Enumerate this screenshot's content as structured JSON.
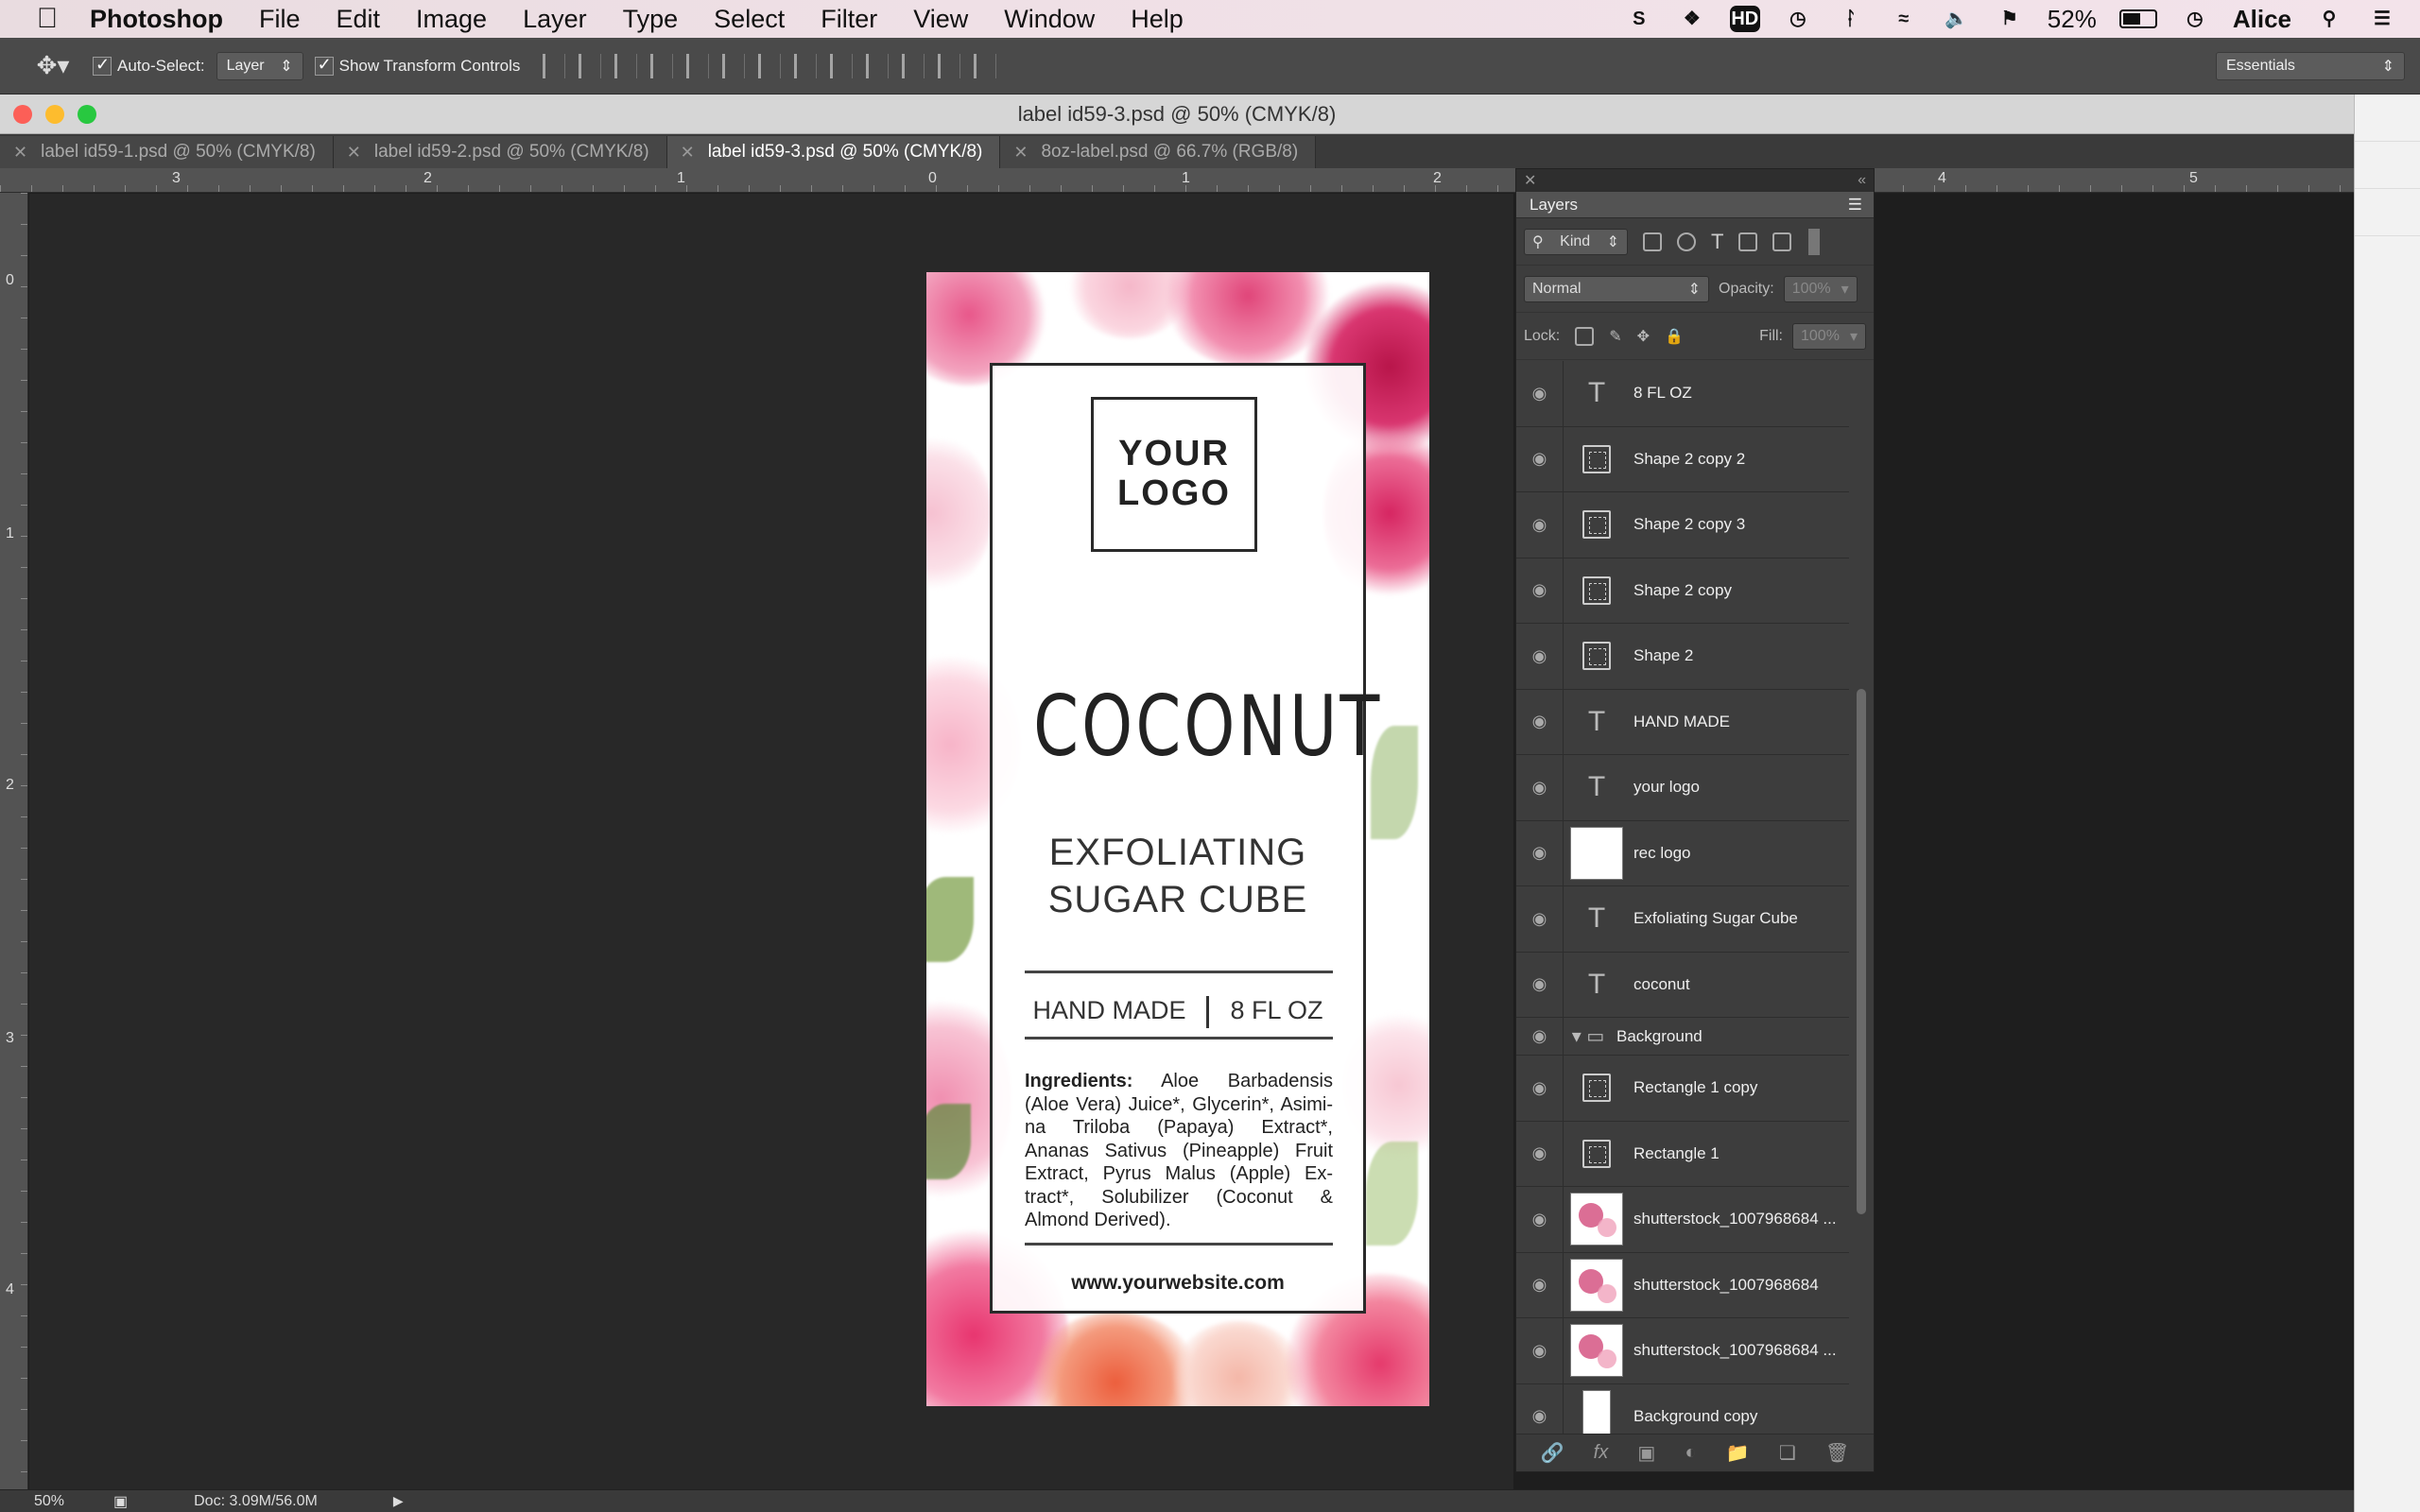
{
  "menubar": {
    "app": "Photoshop",
    "items": [
      "File",
      "Edit",
      "Image",
      "Layer",
      "Type",
      "Select",
      "Filter",
      "View",
      "Window",
      "Help"
    ],
    "battery": "52%",
    "user": "Alice",
    "hd_icon": "HD"
  },
  "options": {
    "auto_select_label": "Auto-Select:",
    "auto_select_value": "Layer",
    "transform_label": "Show Transform Controls",
    "workspace": "Essentials"
  },
  "window": {
    "title": "label id59-3.psd @ 50% (CMYK/8)",
    "tabs": [
      {
        "label": "label id59-1.psd @ 50% (CMYK/8)",
        "active": false
      },
      {
        "label": "label id59-2.psd @ 50% (CMYK/8)",
        "active": false
      },
      {
        "label": "label id59-3.psd @ 50% (CMYK/8)",
        "active": true
      },
      {
        "label": "8oz-label.psd @ 66.7% (RGB/8)",
        "active": false
      }
    ]
  },
  "rulers": {
    "h": [
      "3",
      "2",
      "1",
      "0",
      "1",
      "2",
      "4",
      "5"
    ],
    "v": [
      "0",
      "1",
      "2",
      "3",
      "4"
    ]
  },
  "label": {
    "logo_line1": "YOUR",
    "logo_line2": "LOGO",
    "title": "COCONUT",
    "subtitle_line1": "EXFOLIATING",
    "subtitle_line2": "SUGAR CUBE",
    "hand_made": "HAND MADE",
    "volume": "8 FL OZ",
    "ingredients_label": "Ingredients:",
    "ingredients_text": "Aloe Barbadensis (Aloe Vera) Juice*, Glycerin*, Asimi-na Triloba (Papaya) Extract*, Ananas Sativus (Pineapple) Fruit Extract, Pyrus Malus (Apple) Ex-tract*, Solubilizer (Coconut & Almond Derived).",
    "website": "www.yourwebsite.com"
  },
  "layers_panel": {
    "tab": "Layers",
    "filter": "Kind",
    "blend_mode": "Normal",
    "opacity_label": "Opacity:",
    "opacity": "100%",
    "lock_label": "Lock:",
    "fill_label": "Fill:",
    "fill": "100%",
    "layers": [
      {
        "name": "8 FL OZ",
        "type": "text"
      },
      {
        "name": "Shape 2 copy 2",
        "type": "shape"
      },
      {
        "name": "Shape 2 copy 3",
        "type": "shape"
      },
      {
        "name": "Shape 2 copy",
        "type": "shape"
      },
      {
        "name": "Shape 2",
        "type": "shape"
      },
      {
        "name": "HAND MADE",
        "type": "text"
      },
      {
        "name": "your  logo",
        "type": "text"
      },
      {
        "name": "rec logo",
        "type": "smart"
      },
      {
        "name": "Exfoliating Sugar Cube",
        "type": "text"
      },
      {
        "name": "coconut",
        "type": "text"
      },
      {
        "name": "Background",
        "type": "group"
      },
      {
        "name": "Rectangle 1 copy",
        "type": "shape"
      },
      {
        "name": "Rectangle 1",
        "type": "shape"
      },
      {
        "name": "shutterstock_1007968684 ...",
        "type": "image"
      },
      {
        "name": "shutterstock_1007968684",
        "type": "image"
      },
      {
        "name": "shutterstock_1007968684 ...",
        "type": "image"
      },
      {
        "name": "Background copy",
        "type": "white"
      }
    ]
  },
  "status": {
    "zoom": "50%",
    "doc": "Doc: 3.09M/56.0M"
  },
  "colors": {
    "ui_dark": "#282828",
    "panel": "#3d3d3d",
    "accent_pink": "#d9467a"
  }
}
